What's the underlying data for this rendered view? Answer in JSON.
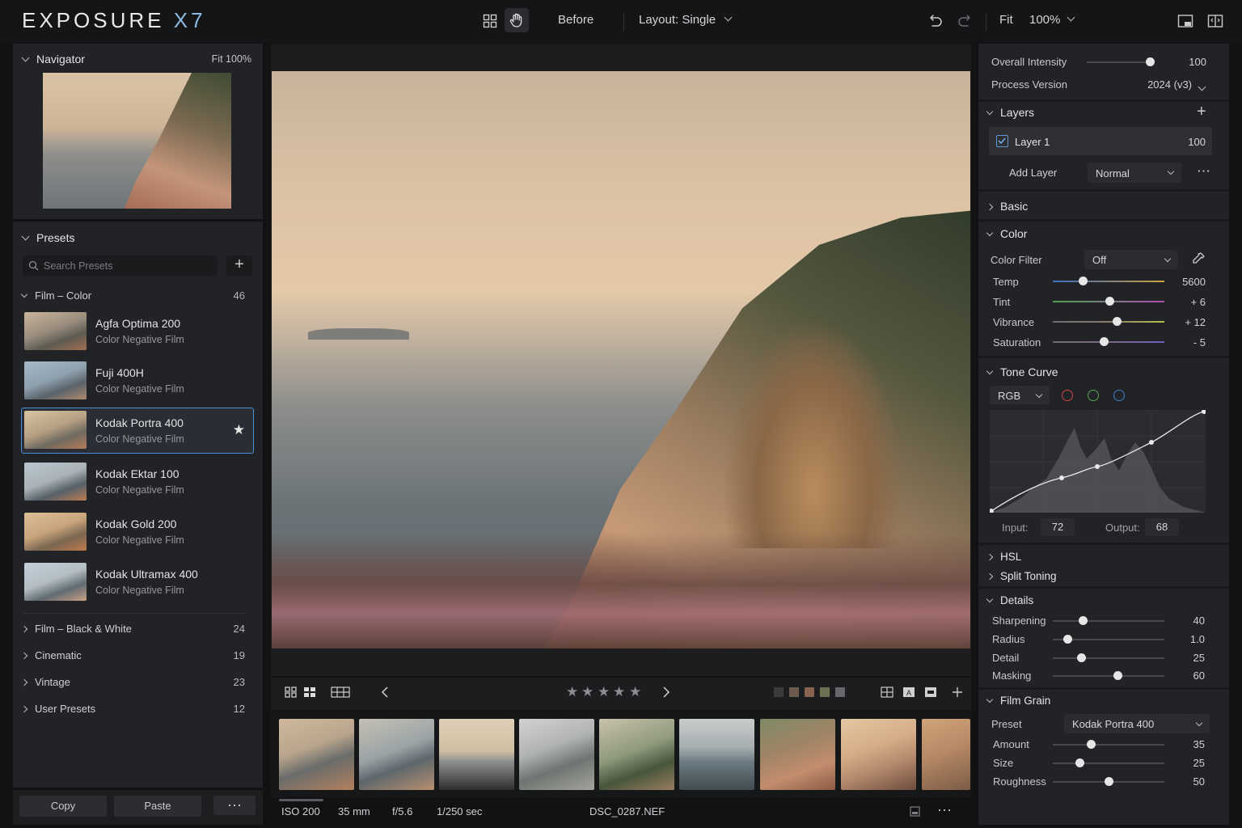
{
  "app": {
    "logo_main": "EXPOSURE",
    "logo_x": "X7"
  },
  "toolbar": {
    "before_label": "Before",
    "layout_label": "Layout: Single",
    "fit_label": "Fit",
    "zoom_label": "100%"
  },
  "navigator": {
    "title": "Navigator",
    "zoom": "Fit 100%"
  },
  "presets": {
    "title": "Presets",
    "search_placeholder": "Search Presets",
    "group_open": {
      "name": "Film – Color",
      "count": "46"
    },
    "items": [
      {
        "name": "Agfa Optima 200",
        "sub": "Color Negative Film"
      },
      {
        "name": "Fuji 400H",
        "sub": "Color Negative Film"
      },
      {
        "name": "Kodak Portra 400",
        "sub": "Color Negative Film"
      },
      {
        "name": "Kodak Ektar 100",
        "sub": "Color Negative Film"
      },
      {
        "name": "Kodak Gold 200",
        "sub": "Color Negative Film"
      },
      {
        "name": "Kodak Ultramax 400",
        "sub": "Color Negative Film"
      }
    ],
    "selected_index": 2,
    "groups": [
      {
        "name": "Film – Black & White",
        "count": "24"
      },
      {
        "name": "Cinematic",
        "count": "19"
      },
      {
        "name": "Vintage",
        "count": "23"
      },
      {
        "name": "User Presets",
        "count": "12"
      }
    ],
    "copy_label": "Copy",
    "paste_label": "Paste",
    "more_label": "⋯"
  },
  "status": {
    "iso": "ISO 200",
    "focal": "35 mm",
    "aperture": "f/5.6",
    "shutter": "1/250 sec",
    "filename": "DSC_0287.NEF"
  },
  "right": {
    "overall_intensity": {
      "label": "Overall Intensity",
      "value": "100",
      "level": 1.0
    },
    "process_version": {
      "label": "Process Version",
      "value": "2024 (v3)"
    },
    "layers": {
      "title": "Layers",
      "layer1_name": "Layer 1",
      "layer1_value": "100",
      "add_layer": "Add Layer",
      "blend_mode": "Normal"
    },
    "basic": {
      "title": "Basic"
    },
    "color": {
      "title": "Color",
      "filter_label": "Color Filter",
      "filter_value": "Off",
      "temp": {
        "label": "Temp",
        "value": "5600",
        "level": 0.27
      },
      "tint": {
        "label": "Tint",
        "value": "+ 6",
        "level": 0.51
      },
      "vibrance": {
        "label": "Vibrance",
        "value": "+ 12",
        "level": 0.57
      },
      "saturation": {
        "label": "Saturation",
        "value": "- 5",
        "level": 0.46
      }
    },
    "tone_curve": {
      "title": "Tone Curve",
      "channel": "RGB",
      "input_label": "Input:",
      "input_value": "72",
      "output_label": "Output:",
      "output_value": "68"
    },
    "hsl": {
      "title": "HSL"
    },
    "split_toning": {
      "title": "Split Toning"
    },
    "details": {
      "title": "Details",
      "sharpening": {
        "label": "Sharpening",
        "value": "40",
        "level": 0.27
      },
      "radius": {
        "label": "Radius",
        "value": "1.0",
        "level": 0.13
      },
      "detail": {
        "label": "Detail",
        "value": "25",
        "level": 0.25
      },
      "masking": {
        "label": "Masking",
        "value": "60",
        "level": 0.58
      }
    },
    "film_grain": {
      "title": "Film Grain",
      "preset_label": "Preset",
      "preset_value": "Kodak Portra 400",
      "amount": {
        "label": "Amount",
        "value": "35",
        "level": 0.34
      },
      "size": {
        "label": "Size",
        "value": "25",
        "level": 0.24
      },
      "roughness": {
        "label": "Roughness",
        "value": "50",
        "level": 0.5
      }
    }
  },
  "colors": {
    "accent": "#4a8fd8",
    "panel": "#222326",
    "background": "#111214"
  }
}
